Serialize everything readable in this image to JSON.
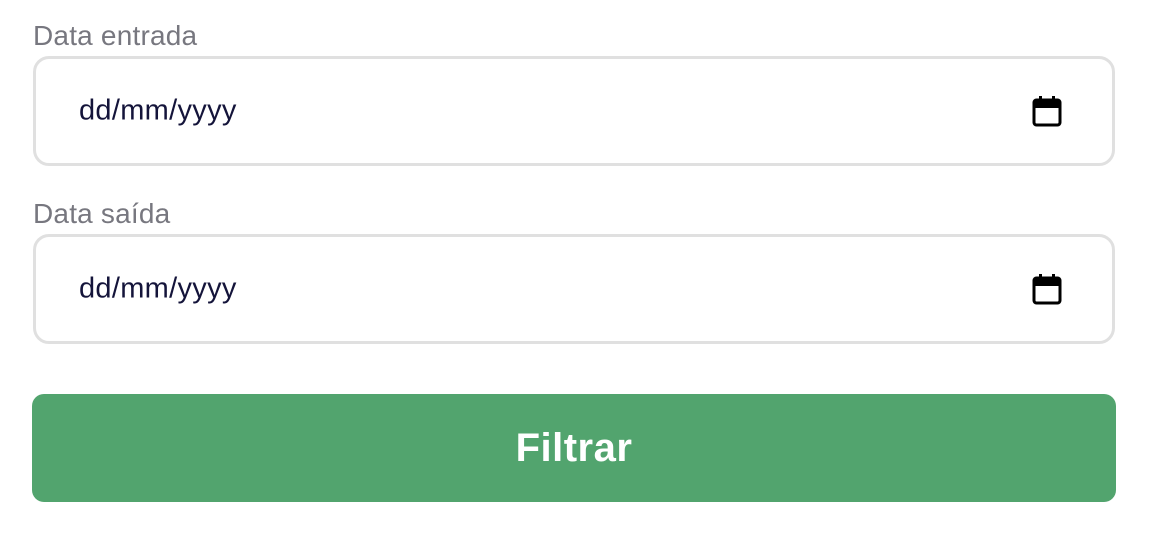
{
  "form": {
    "entrada": {
      "label": "Data entrada",
      "placeholder": "dd/mm/yyyy",
      "icon": "calendar-icon"
    },
    "saida": {
      "label": "Data saída",
      "placeholder": "dd/mm/yyyy",
      "icon": "calendar-icon"
    },
    "submit_label": "Filtrar"
  },
  "colors": {
    "button_bg": "#52a46e",
    "label_text": "#77777f",
    "input_text": "#14143a",
    "input_border": "#e0e0e0"
  }
}
